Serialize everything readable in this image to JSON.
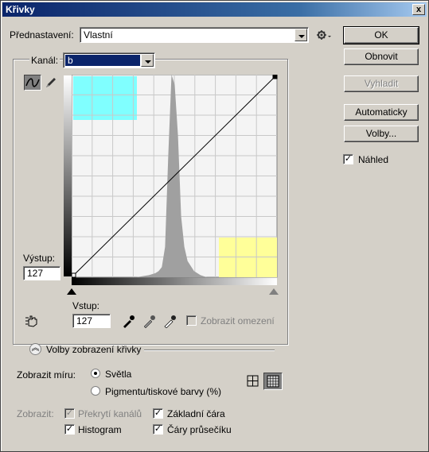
{
  "window": {
    "title": "Křivky",
    "close_label": "x"
  },
  "preset": {
    "label": "Přednastavení:",
    "value": "Vlastní"
  },
  "channel": {
    "label": "Kanál:",
    "value": "b"
  },
  "buttons": {
    "ok": "OK",
    "reset": "Obnovit",
    "smooth": "Vyhladit",
    "auto": "Automaticky",
    "options": "Volby..."
  },
  "preview": {
    "label": "Náhled",
    "checked": true
  },
  "output": {
    "label": "Výstup:",
    "value": "127"
  },
  "input": {
    "label": "Vstup:",
    "value": "127"
  },
  "show_clipping": {
    "label": "Zobrazit omezení",
    "checked": false,
    "enabled": false
  },
  "curve_display_options": {
    "label": "Volby zobrazení křivky"
  },
  "show_amount": {
    "label": "Zobrazit míru:",
    "options": [
      "Světla",
      "Pigmentu/tiskové barvy (%)"
    ],
    "selected": 0
  },
  "show": {
    "label": "Zobrazit:",
    "channel_overlays": {
      "label": "Překrytí kanálů",
      "checked": true,
      "enabled": false
    },
    "histogram": {
      "label": "Histogram",
      "checked": true
    },
    "baseline": {
      "label": "Základní čára",
      "checked": true
    },
    "intersection_lines": {
      "label": "Čáry průsečíku",
      "checked": true
    }
  },
  "colors": {
    "cyan_patch": "#80ffff",
    "yellow_patch": "#ffff99",
    "histogram": "#a0a0a0",
    "grid_bg": "#f4f4f4"
  },
  "chart_data": {
    "type": "area",
    "x": [
      0,
      16,
      32,
      48,
      64,
      80,
      96,
      104,
      108,
      112,
      116,
      120,
      124,
      128,
      132,
      136,
      140,
      144,
      152,
      160,
      168,
      176,
      192,
      208,
      224,
      240,
      255
    ],
    "histogram": [
      0,
      0,
      0,
      0,
      0,
      0,
      0.01,
      0.02,
      0.03,
      0.05,
      0.15,
      0.6,
      1.0,
      0.95,
      0.7,
      0.3,
      0.15,
      0.08,
      0.03,
      0.01,
      0,
      0,
      0,
      0,
      0,
      0,
      0
    ],
    "curve_points": [
      [
        0,
        0
      ],
      [
        255,
        255
      ]
    ],
    "xlim": [
      0,
      255
    ],
    "ylim": [
      0,
      255
    ],
    "grid": true
  }
}
